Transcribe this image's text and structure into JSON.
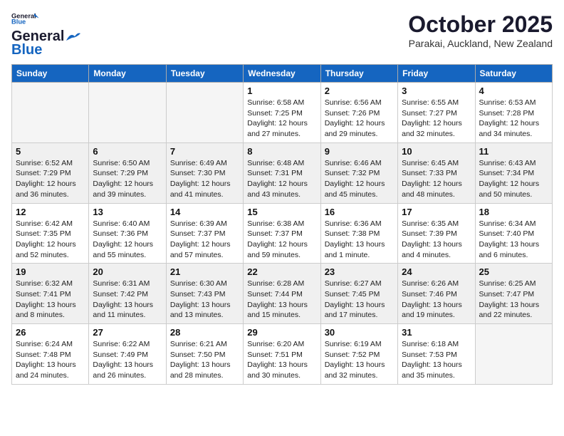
{
  "header": {
    "logo_line1": "General",
    "logo_line2": "Blue",
    "title": "October 2025",
    "subtitle": "Parakai, Auckland, New Zealand"
  },
  "weekdays": [
    "Sunday",
    "Monday",
    "Tuesday",
    "Wednesday",
    "Thursday",
    "Friday",
    "Saturday"
  ],
  "weeks": [
    [
      {
        "day": "",
        "info": ""
      },
      {
        "day": "",
        "info": ""
      },
      {
        "day": "",
        "info": ""
      },
      {
        "day": "1",
        "info": "Sunrise: 6:58 AM\nSunset: 7:25 PM\nDaylight: 12 hours\nand 27 minutes."
      },
      {
        "day": "2",
        "info": "Sunrise: 6:56 AM\nSunset: 7:26 PM\nDaylight: 12 hours\nand 29 minutes."
      },
      {
        "day": "3",
        "info": "Sunrise: 6:55 AM\nSunset: 7:27 PM\nDaylight: 12 hours\nand 32 minutes."
      },
      {
        "day": "4",
        "info": "Sunrise: 6:53 AM\nSunset: 7:28 PM\nDaylight: 12 hours\nand 34 minutes."
      }
    ],
    [
      {
        "day": "5",
        "info": "Sunrise: 6:52 AM\nSunset: 7:29 PM\nDaylight: 12 hours\nand 36 minutes."
      },
      {
        "day": "6",
        "info": "Sunrise: 6:50 AM\nSunset: 7:29 PM\nDaylight: 12 hours\nand 39 minutes."
      },
      {
        "day": "7",
        "info": "Sunrise: 6:49 AM\nSunset: 7:30 PM\nDaylight: 12 hours\nand 41 minutes."
      },
      {
        "day": "8",
        "info": "Sunrise: 6:48 AM\nSunset: 7:31 PM\nDaylight: 12 hours\nand 43 minutes."
      },
      {
        "day": "9",
        "info": "Sunrise: 6:46 AM\nSunset: 7:32 PM\nDaylight: 12 hours\nand 45 minutes."
      },
      {
        "day": "10",
        "info": "Sunrise: 6:45 AM\nSunset: 7:33 PM\nDaylight: 12 hours\nand 48 minutes."
      },
      {
        "day": "11",
        "info": "Sunrise: 6:43 AM\nSunset: 7:34 PM\nDaylight: 12 hours\nand 50 minutes."
      }
    ],
    [
      {
        "day": "12",
        "info": "Sunrise: 6:42 AM\nSunset: 7:35 PM\nDaylight: 12 hours\nand 52 minutes."
      },
      {
        "day": "13",
        "info": "Sunrise: 6:40 AM\nSunset: 7:36 PM\nDaylight: 12 hours\nand 55 minutes."
      },
      {
        "day": "14",
        "info": "Sunrise: 6:39 AM\nSunset: 7:37 PM\nDaylight: 12 hours\nand 57 minutes."
      },
      {
        "day": "15",
        "info": "Sunrise: 6:38 AM\nSunset: 7:37 PM\nDaylight: 12 hours\nand 59 minutes."
      },
      {
        "day": "16",
        "info": "Sunrise: 6:36 AM\nSunset: 7:38 PM\nDaylight: 13 hours\nand 1 minute."
      },
      {
        "day": "17",
        "info": "Sunrise: 6:35 AM\nSunset: 7:39 PM\nDaylight: 13 hours\nand 4 minutes."
      },
      {
        "day": "18",
        "info": "Sunrise: 6:34 AM\nSunset: 7:40 PM\nDaylight: 13 hours\nand 6 minutes."
      }
    ],
    [
      {
        "day": "19",
        "info": "Sunrise: 6:32 AM\nSunset: 7:41 PM\nDaylight: 13 hours\nand 8 minutes."
      },
      {
        "day": "20",
        "info": "Sunrise: 6:31 AM\nSunset: 7:42 PM\nDaylight: 13 hours\nand 11 minutes."
      },
      {
        "day": "21",
        "info": "Sunrise: 6:30 AM\nSunset: 7:43 PM\nDaylight: 13 hours\nand 13 minutes."
      },
      {
        "day": "22",
        "info": "Sunrise: 6:28 AM\nSunset: 7:44 PM\nDaylight: 13 hours\nand 15 minutes."
      },
      {
        "day": "23",
        "info": "Sunrise: 6:27 AM\nSunset: 7:45 PM\nDaylight: 13 hours\nand 17 minutes."
      },
      {
        "day": "24",
        "info": "Sunrise: 6:26 AM\nSunset: 7:46 PM\nDaylight: 13 hours\nand 19 minutes."
      },
      {
        "day": "25",
        "info": "Sunrise: 6:25 AM\nSunset: 7:47 PM\nDaylight: 13 hours\nand 22 minutes."
      }
    ],
    [
      {
        "day": "26",
        "info": "Sunrise: 6:24 AM\nSunset: 7:48 PM\nDaylight: 13 hours\nand 24 minutes."
      },
      {
        "day": "27",
        "info": "Sunrise: 6:22 AM\nSunset: 7:49 PM\nDaylight: 13 hours\nand 26 minutes."
      },
      {
        "day": "28",
        "info": "Sunrise: 6:21 AM\nSunset: 7:50 PM\nDaylight: 13 hours\nand 28 minutes."
      },
      {
        "day": "29",
        "info": "Sunrise: 6:20 AM\nSunset: 7:51 PM\nDaylight: 13 hours\nand 30 minutes."
      },
      {
        "day": "30",
        "info": "Sunrise: 6:19 AM\nSunset: 7:52 PM\nDaylight: 13 hours\nand 32 minutes."
      },
      {
        "day": "31",
        "info": "Sunrise: 6:18 AM\nSunset: 7:53 PM\nDaylight: 13 hours\nand 35 minutes."
      },
      {
        "day": "",
        "info": ""
      }
    ]
  ]
}
